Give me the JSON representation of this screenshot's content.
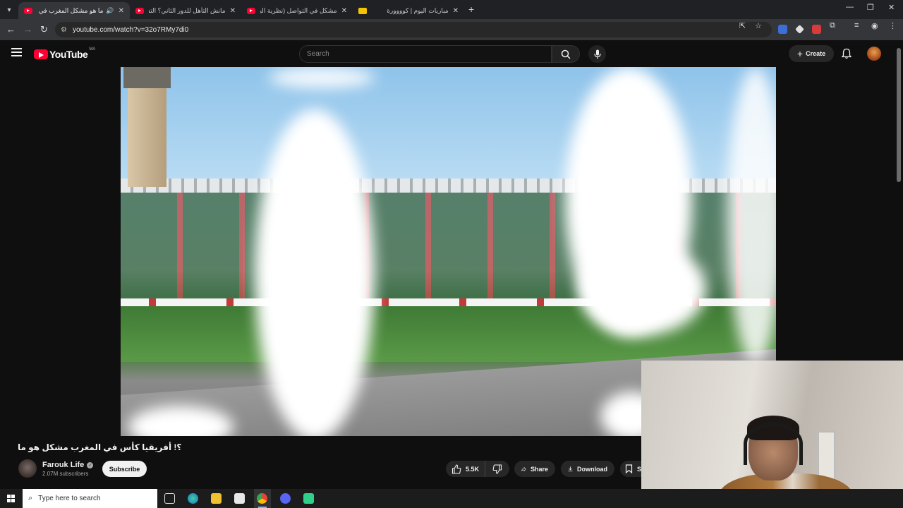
{
  "browser": {
    "tabs": [
      {
        "title": "ما هو مشكل المغرب في كأس",
        "active": true,
        "audio": true
      },
      {
        "title": "مانش التأهل للدور الثاني؟ التشك",
        "active": false
      },
      {
        "title": "مشكل في التواصل (نظرية البراك",
        "active": false
      },
      {
        "title": "مباريات اليوم | كوووورة",
        "active": false
      }
    ],
    "url": "youtube.com/watch?v=32o7RMy7di0"
  },
  "youtube": {
    "logo_text": "YouTube",
    "region": "MA",
    "search_placeholder": "Search",
    "create_label": "Create"
  },
  "video": {
    "title": "؟! أفريقيا كأس في المغرب مشكل هو ما",
    "channel_name": "Farouk Life",
    "subscribers": "2.07M subscribers",
    "subscribe_label": "Subscribe",
    "likes": "5.5K",
    "share_label": "Share",
    "download_label": "Download",
    "save_label_partial": "S"
  },
  "taskbar": {
    "search_placeholder": "Type here to search"
  },
  "colors": {
    "yt_red": "#ff0033",
    "bg": "#0f0f0f",
    "pill": "#272727"
  }
}
